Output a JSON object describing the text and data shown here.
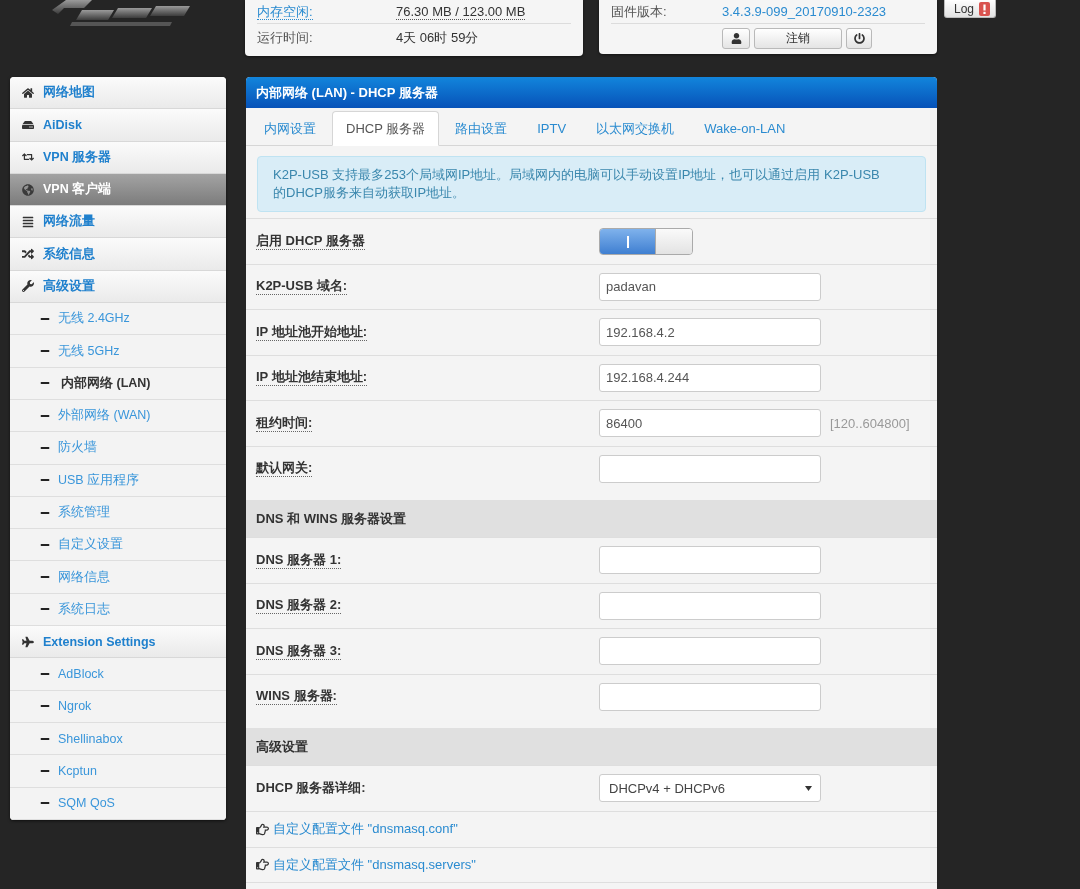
{
  "status_cards": [
    {
      "rows": [
        {
          "kind": "link-label",
          "label": "内存空闲:",
          "value": "76.30 MB / 123.00 MB"
        },
        {
          "kind": "plain",
          "label": "运行时间:",
          "value": "4天 06时 59分"
        }
      ]
    },
    {
      "rows": [
        {
          "kind": "link-value",
          "label": "固件版本:",
          "value": "3.4.3.9-099_20170910-2323"
        }
      ],
      "logout_button": "注销"
    }
  ],
  "log_button": {
    "label": "Log",
    "alert": true
  },
  "sidebar": {
    "items": [
      {
        "label": "网络地图",
        "selected": false
      },
      {
        "label": "AiDisk",
        "selected": false
      },
      {
        "label": "VPN 服务器",
        "selected": false
      },
      {
        "label": "VPN 客户端",
        "selected": true
      },
      {
        "label": "网络流量",
        "selected": false
      },
      {
        "label": "系统信息",
        "selected": false
      },
      {
        "label": "高级设置",
        "selected": false,
        "children": [
          {
            "label": "无线 2.4GHz",
            "selected": false
          },
          {
            "label": "无线 5GHz",
            "selected": false
          },
          {
            "label": "内部网络 (LAN)",
            "selected": true
          },
          {
            "label": "外部网络 (WAN)",
            "selected": false
          },
          {
            "label": "防火墙",
            "selected": false
          },
          {
            "label": "USB 应用程序",
            "selected": false
          },
          {
            "label": "系统管理",
            "selected": false
          },
          {
            "label": "自定义设置",
            "selected": false
          },
          {
            "label": "网络信息",
            "selected": false
          },
          {
            "label": "系统日志",
            "selected": false
          }
        ]
      },
      {
        "label": "Extension Settings",
        "selected": false,
        "children": [
          {
            "label": "AdBlock",
            "selected": false
          },
          {
            "label": "Ngrok",
            "selected": false
          },
          {
            "label": "Shellinabox",
            "selected": false
          },
          {
            "label": "Kcptun",
            "selected": false
          },
          {
            "label": "SQM QoS",
            "selected": false
          }
        ]
      }
    ]
  },
  "panel": {
    "title": "内部网络 (LAN) - DHCP 服务器",
    "tabs": [
      {
        "label": "内网设置",
        "selected": false
      },
      {
        "label": "DHCP 服务器",
        "selected": true
      },
      {
        "label": "路由设置",
        "selected": false
      },
      {
        "label": "IPTV",
        "selected": false
      },
      {
        "label": "以太网交换机",
        "selected": false
      },
      {
        "label": "Wake-on-LAN",
        "selected": false
      }
    ],
    "notice": "K2P-USB 支持最多253个局域网IP地址。局域网内的电脑可以手动设置IP地址，也可以通过启用 K2P-USB 的DHCP服务来自动获取IP地址。",
    "sections": [
      {
        "rows": [
          {
            "kind": "toggle",
            "label": "启用 DHCP 服务器",
            "hint": true,
            "on": true
          },
          {
            "kind": "text",
            "label": "K2P-USB 域名:",
            "hint": true,
            "value": "padavan"
          },
          {
            "kind": "text",
            "label": "IP 地址池开始地址:",
            "hint": true,
            "value": "192.168.4.2"
          },
          {
            "kind": "text",
            "label": "IP 地址池结束地址:",
            "hint": true,
            "value": "192.168.4.244"
          },
          {
            "kind": "text",
            "label": "租约时间:",
            "hint": true,
            "value": "86400",
            "suffix": "[120..604800]"
          },
          {
            "kind": "text",
            "label": "默认网关:",
            "hint": true
          }
        ]
      },
      {
        "heading": "DNS 和 WINS 服务器设置",
        "rows": [
          {
            "kind": "text",
            "label": "DNS 服务器 1:",
            "hint": true
          },
          {
            "kind": "text",
            "label": "DNS 服务器 2:",
            "hint": true
          },
          {
            "kind": "text",
            "label": "DNS 服务器 3:",
            "hint": true
          },
          {
            "kind": "text",
            "label": "WINS 服务器:",
            "hint": true
          }
        ]
      },
      {
        "heading": "高级设置",
        "rows": [
          {
            "kind": "select",
            "label": "DHCP 服务器详细:",
            "hint": false,
            "value": "DHCPv4 + DHCPv6"
          },
          {
            "kind": "link",
            "label": "自定义配置文件 \"dnsmasq.conf\""
          },
          {
            "kind": "link",
            "label": "自定义配置文件 \"dnsmasq.servers\""
          }
        ]
      }
    ]
  }
}
